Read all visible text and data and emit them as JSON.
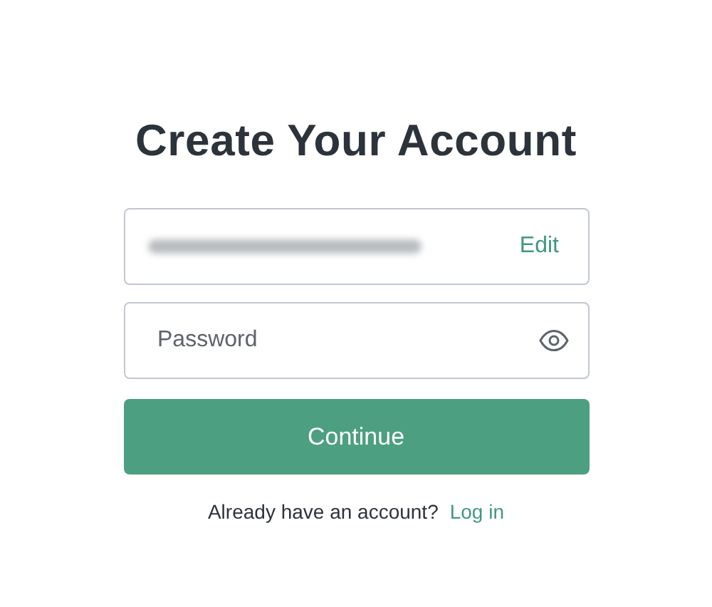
{
  "title": "Create Your Account",
  "email_field": {
    "redacted": true,
    "action": "Edit"
  },
  "password_field": {
    "placeholder": "Password"
  },
  "continue_button": "Continue",
  "footer": {
    "text": "Already have an account?",
    "link": "Log in"
  }
}
